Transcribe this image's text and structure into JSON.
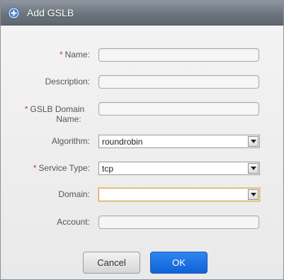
{
  "dialog": {
    "title": "Add GSLB",
    "icon": "add-circle-icon"
  },
  "form": {
    "name": {
      "label": "Name:",
      "required": true,
      "value": ""
    },
    "description": {
      "label": "Description:",
      "required": false,
      "value": ""
    },
    "gslb_domain_name": {
      "label_line1": "GSLB Domain",
      "label_line2": "Name:",
      "required": true,
      "value": ""
    },
    "algorithm": {
      "label": "Algorithm:",
      "required": false,
      "selected": "roundrobin"
    },
    "service_type": {
      "label": "Service Type:",
      "required": true,
      "selected": "tcp"
    },
    "domain": {
      "label": "Domain:",
      "required": false,
      "selected": ""
    },
    "account": {
      "label": "Account:",
      "required": false,
      "value": ""
    }
  },
  "required_marker": "*",
  "buttons": {
    "cancel": "Cancel",
    "ok": "OK"
  },
  "colors": {
    "titlebar": "#6c747d",
    "required": "#c63a3a",
    "primary_button": "#1f73e2",
    "focus_border": "#d9a34a"
  }
}
